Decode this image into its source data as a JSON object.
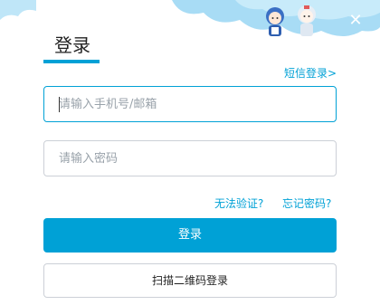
{
  "header": {
    "title": "登录",
    "close_icon": "close-icon"
  },
  "links": {
    "sms_login": "短信登录>",
    "cannot_verify": "无法验证?",
    "forgot_password": "忘记密码?"
  },
  "form": {
    "account": {
      "value": "",
      "placeholder": "请输入手机号/邮箱"
    },
    "password": {
      "value": "",
      "placeholder": "请输入密码"
    }
  },
  "buttons": {
    "login": "登录",
    "qr_login": "扫描二维码登录"
  },
  "colors": {
    "accent": "#00a1d6",
    "sky": "#a8dcf5",
    "border": "#ccd0d7"
  }
}
